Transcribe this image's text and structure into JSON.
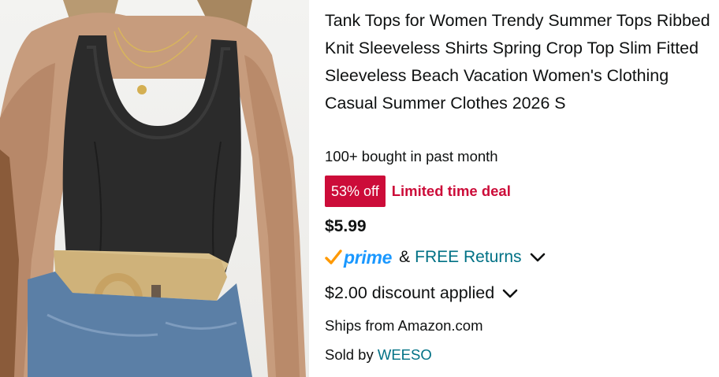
{
  "product": {
    "image_alt": "Woman wearing black ribbed tank top with rattan buckle belt and denim jeans",
    "title": "Tank Tops for Women Trendy Summer Tops Ribbed Knit Sleeveless Shirts Spring Crop Top Slim Fitted Sleeveless Beach Vacation Women's Clothing Casual Summer Clothes 2026 S",
    "bought": "100+ bought in past month",
    "deal_badge": "53% off",
    "deal_text": "Limited time deal",
    "price": "$5.99",
    "prime_word": "prime",
    "prime_amp": "&",
    "free_returns": "FREE Returns",
    "discount": "$2.00 discount applied",
    "ships_from": "Ships from Amazon.com",
    "sold_by_label": "Sold by",
    "seller": "WEESO"
  },
  "colors": {
    "deal_red": "#cc0c39",
    "link_teal": "#007185",
    "prime_blue": "#1a98ff",
    "prime_check": "#ff9900",
    "text": "#0f1111"
  },
  "icons": {
    "prime_check": "prime-check-icon",
    "returns_chevron": "chevron-down-icon",
    "discount_chevron": "chevron-down-icon"
  }
}
